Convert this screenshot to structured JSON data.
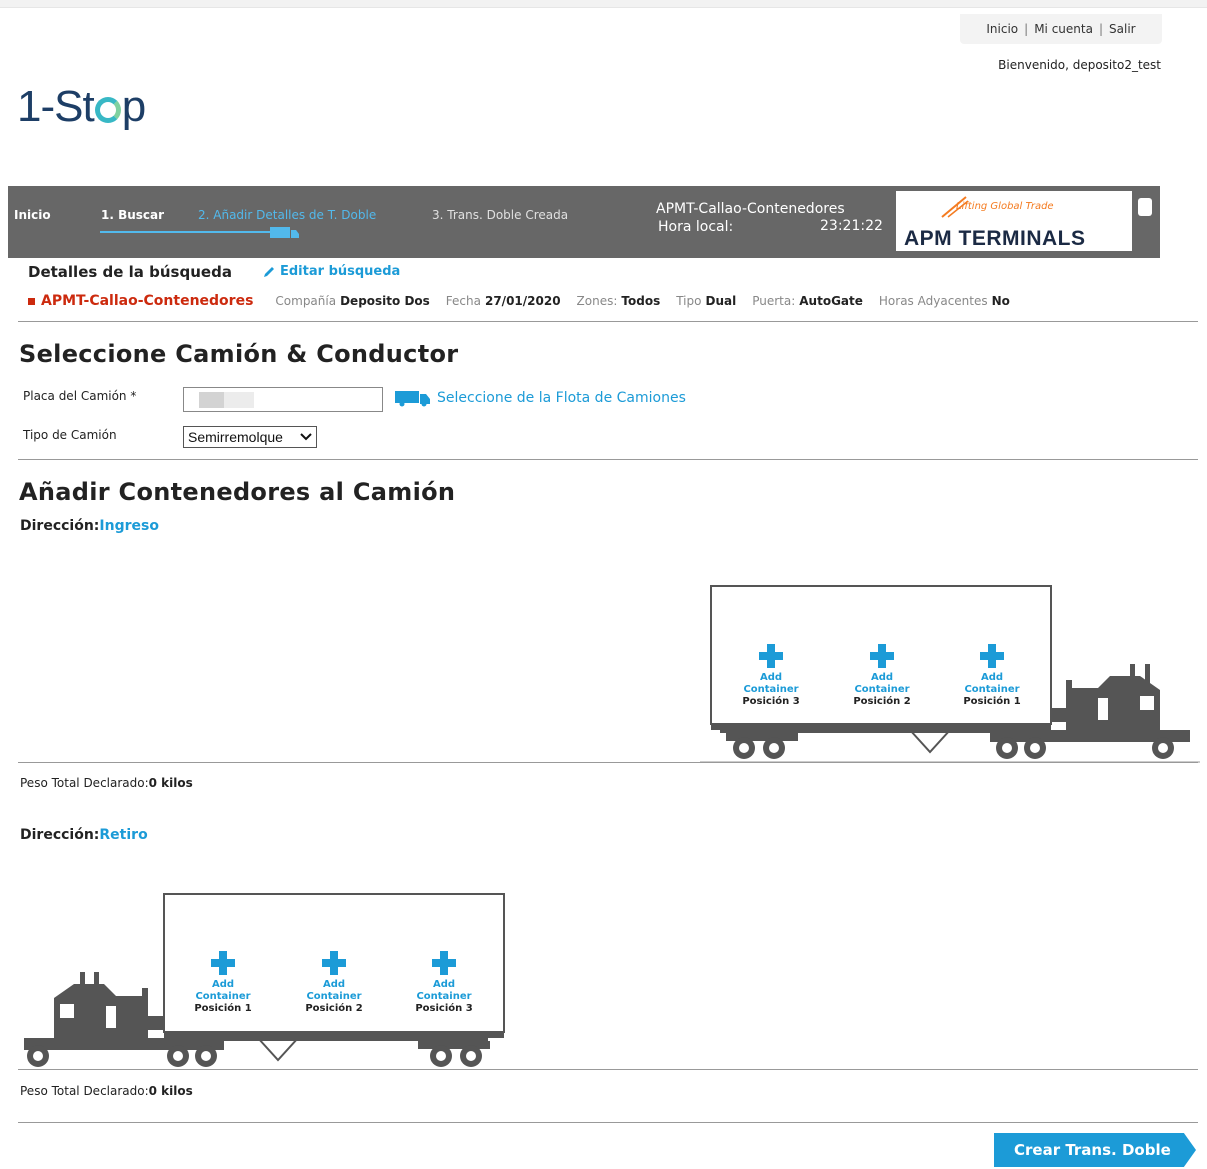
{
  "top_links": {
    "inicio": "Inicio",
    "mi_cuenta": "Mi cuenta",
    "salir": "Salir",
    "separator": "|"
  },
  "welcome": "Bienvenido, deposito2_test",
  "logo": {
    "text_before": "1-St",
    "text_after": "p"
  },
  "nav": {
    "inicio": "Inicio",
    "step1": "1. Buscar",
    "step2": "2. Añadir Detalles de T. Doble",
    "step3": "3. Trans. Doble Creada",
    "terminal": "APMT-Callao-Contenedores",
    "hora_label": "Hora local:",
    "hora_value": "23:21:22",
    "brand_tagline": "Lifting Global Trade",
    "brand_name": "APM TERMINALS"
  },
  "search": {
    "title": "Detalles de la búsqueda",
    "edit": "Editar búsqueda",
    "terminal": "APMT-Callao-Contenedores",
    "fields": [
      {
        "label": "Compañía",
        "value": "Deposito Dos"
      },
      {
        "label": "Fecha",
        "value": "27/01/2020"
      },
      {
        "label": "Zones:",
        "value": "Todos"
      },
      {
        "label": "Tipo",
        "value": "Dual"
      },
      {
        "label": "Puerta:",
        "value": "AutoGate"
      },
      {
        "label": "Horas Adyacentes",
        "value": "No"
      }
    ]
  },
  "truck_section": {
    "title": "Seleccione Camión & Conductor",
    "plate_label": "Placa del Camión *",
    "fleet_link": "Seleccione de la Flota de Camiones",
    "type_label": "Tipo de Camión",
    "type_value": "Semirremolque"
  },
  "containers_section": {
    "title": "Añadir Contenedores al Camión",
    "direction_label": "Dirección:",
    "ingreso": {
      "direction": "Ingreso",
      "slots": [
        {
          "add": "Add Container",
          "pos": "Posición 3"
        },
        {
          "add": "Add Container",
          "pos": "Posición 2"
        },
        {
          "add": "Add Container",
          "pos": "Posición 1"
        }
      ],
      "weight_label": "Peso Total Declarado:",
      "weight_value": "0 kilos"
    },
    "retiro": {
      "direction": "Retiro",
      "slots": [
        {
          "add": "Add Container",
          "pos": "Posición 1"
        },
        {
          "add": "Add Container",
          "pos": "Posición 2"
        },
        {
          "add": "Add Container",
          "pos": "Posición 3"
        }
      ],
      "weight_label": "Peso Total Declarado:",
      "weight_value": "0 kilos"
    }
  },
  "create_button": "Crear Trans. Doble",
  "colors": {
    "accent": "#1c9bd7",
    "nav_bg": "#676767",
    "terminal_red": "#cc2a0e",
    "truck": "#555555"
  }
}
